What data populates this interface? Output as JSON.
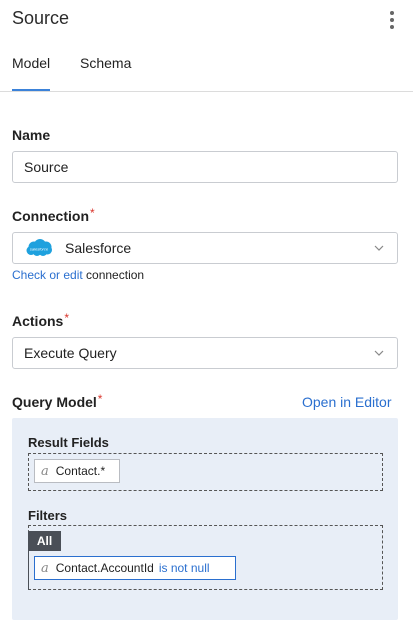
{
  "header": {
    "title": "Source"
  },
  "tabs": [
    {
      "label": "Model",
      "active": true
    },
    {
      "label": "Schema",
      "active": false
    }
  ],
  "name": {
    "label": "Name",
    "value": "Source"
  },
  "connection": {
    "label": "Connection",
    "required": "*",
    "value": "Salesforce",
    "icon": "salesforce-cloud-icon",
    "icon_text": "salesforce",
    "link_text": "Check or edit",
    "link_suffix": " connection"
  },
  "actions": {
    "label": "Actions",
    "required": "*",
    "value": "Execute Query"
  },
  "query_model": {
    "label": "Query Model",
    "required": "*",
    "open_editor": "Open in Editor",
    "result_fields_label": "Result Fields",
    "result_fields": [
      {
        "type_glyph": "a",
        "name": "Contact.*"
      }
    ],
    "filters_label": "Filters",
    "filter_group": "All",
    "filters": [
      {
        "type_glyph": "a",
        "field": "Contact.AccountId",
        "condition": "is not null"
      }
    ]
  },
  "colors": {
    "accent": "#3b82d9",
    "link": "#2a6fcf",
    "required": "#d9342b",
    "panel": "#e8eef7",
    "salesforce": "#1ea1de"
  }
}
